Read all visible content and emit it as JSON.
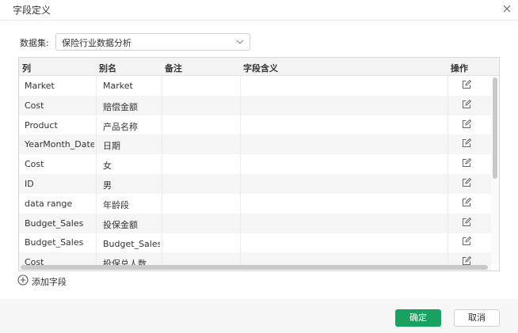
{
  "dialog": {
    "title": "字段定义",
    "close_icon": "close-icon"
  },
  "dataset": {
    "label": "数据集:",
    "selected": "保险行业数据分析"
  },
  "table": {
    "headers": {
      "col": "列",
      "alias": "别名",
      "remark": "备注",
      "meaning": "字段含义",
      "action": "操作"
    },
    "rows": [
      {
        "col": "Market",
        "alias": "Market",
        "remark": "",
        "meaning": ""
      },
      {
        "col": "Cost",
        "alias": "赔偿金额",
        "remark": "",
        "meaning": ""
      },
      {
        "col": "Product",
        "alias": "产品名称",
        "remark": "",
        "meaning": ""
      },
      {
        "col": "YearMonth_Date",
        "alias": "日期",
        "remark": "",
        "meaning": ""
      },
      {
        "col": "Cost",
        "alias": "女",
        "remark": "",
        "meaning": ""
      },
      {
        "col": "ID",
        "alias": "男",
        "remark": "",
        "meaning": ""
      },
      {
        "col": "data range",
        "alias": "年龄段",
        "remark": "",
        "meaning": ""
      },
      {
        "col": "Budget_Sales",
        "alias": "投保金额",
        "remark": "",
        "meaning": ""
      },
      {
        "col": "Budget_Sales",
        "alias": "Budget_Sales_总",
        "remark": "",
        "meaning": ""
      },
      {
        "col": "Cost",
        "alias": "投保总人数",
        "remark": "",
        "meaning": ""
      }
    ],
    "action_icon": "edit-icon"
  },
  "add_field": {
    "label": "添加字段"
  },
  "footer": {
    "ok_label": "确定",
    "cancel_label": "取消"
  },
  "colors": {
    "primary": "#19a15f",
    "row_alt": "#f5f5f5",
    "header_bg": "#f3f3f3"
  }
}
